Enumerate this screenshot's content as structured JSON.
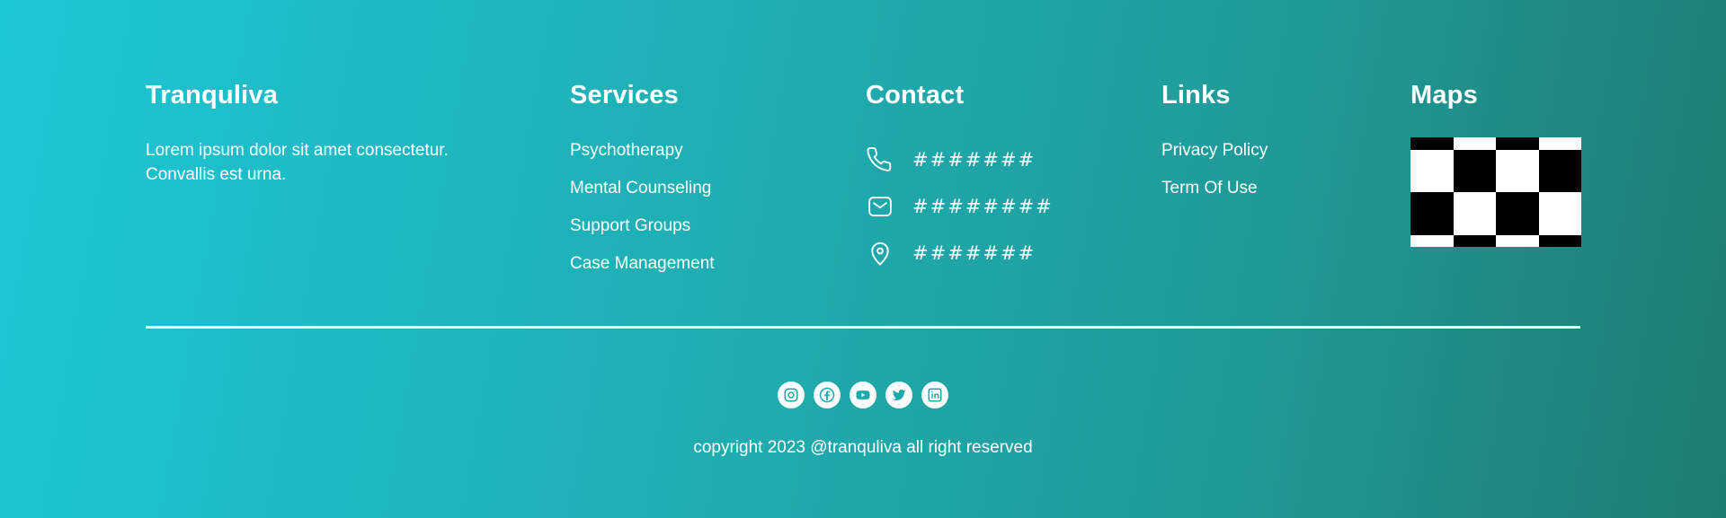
{
  "brand": {
    "name": "Tranquliva",
    "description": "Lorem ipsum dolor sit amet consectetur. Convallis est urna."
  },
  "services": {
    "title": "Services",
    "items": [
      "Psychotherapy",
      "Mental Counseling",
      "Support Groups",
      "Case Management"
    ]
  },
  "contact": {
    "title": "Contact",
    "items": [
      {
        "icon": "phone-icon",
        "value": "#######"
      },
      {
        "icon": "mail-icon",
        "value": "########"
      },
      {
        "icon": "location-pin-icon",
        "value": "#######"
      }
    ]
  },
  "links": {
    "title": "Links",
    "items": [
      "Privacy Policy",
      "Term Of Use"
    ]
  },
  "maps": {
    "title": "Maps"
  },
  "socials": [
    "instagram-icon",
    "facebook-icon",
    "youtube-icon",
    "twitter-icon",
    "linkedin-icon"
  ],
  "copyright": "copyright 2023 @tranquliva all right reserved",
  "colors": {
    "gradient_start": "#1cc7d6",
    "gradient_end": "#1f7c70",
    "icon_fill": "#1fa9ad"
  }
}
